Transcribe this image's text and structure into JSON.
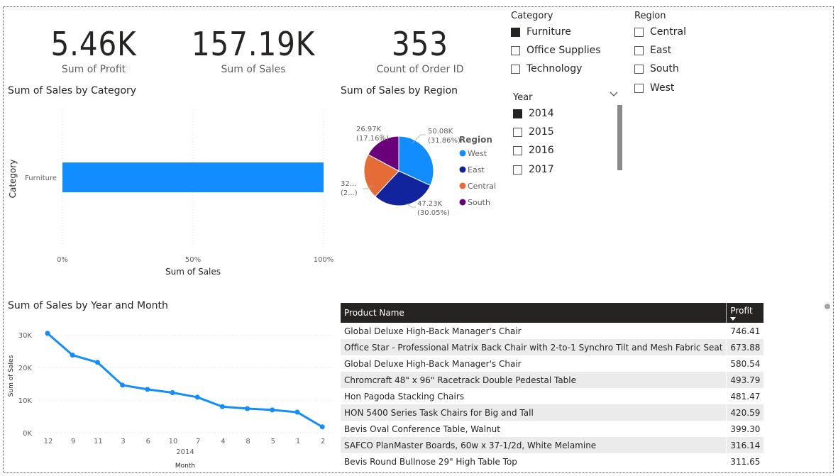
{
  "kpis": [
    {
      "value": "5.46K",
      "label": "Sum of Profit"
    },
    {
      "value": "157.19K",
      "label": "Sum of Sales"
    },
    {
      "value": "353",
      "label": "Count of Order ID"
    }
  ],
  "category_slicer": {
    "title": "Category",
    "options": [
      {
        "label": "Furniture",
        "checked": true
      },
      {
        "label": "Office Supplies",
        "checked": false
      },
      {
        "label": "Technology",
        "checked": false
      }
    ]
  },
  "region_slicer": {
    "title": "Region",
    "options": [
      {
        "label": "Central",
        "checked": false
      },
      {
        "label": "East",
        "checked": false
      },
      {
        "label": "South",
        "checked": false
      },
      {
        "label": "West",
        "checked": false
      }
    ]
  },
  "year_slicer": {
    "title": "Year",
    "chevron_icon": "chevron-down-icon",
    "options": [
      {
        "label": "2014",
        "checked": true
      },
      {
        "label": "2015",
        "checked": false
      },
      {
        "label": "2016",
        "checked": false
      },
      {
        "label": "2017",
        "checked": false
      }
    ]
  },
  "bar_visual": {
    "title": "Sum of Sales by Category"
  },
  "pie_visual": {
    "title": "Sum of Sales by Region"
  },
  "line_visual": {
    "title": "Sum of Sales by Year and Month"
  },
  "table": {
    "columns": [
      "Product Name",
      "Profit"
    ],
    "rows": [
      [
        "Global Deluxe High-Back Manager's Chair",
        "746.41"
      ],
      [
        "Office Star - Professional Matrix Back Chair with 2-to-1 Synchro Tilt and Mesh Fabric Seat",
        "673.88"
      ],
      [
        "Global Deluxe High-Back Manager's Chair",
        "580.54"
      ],
      [
        "Chromcraft 48\" x 96\" Racetrack Double Pedestal Table",
        "493.79"
      ],
      [
        "Hon Pagoda Stacking Chairs",
        "481.47"
      ],
      [
        "HON 5400 Series Task Chairs for Big and Tall",
        "420.59"
      ],
      [
        "Bevis Oval Conference Table, Walnut",
        "399.30"
      ],
      [
        "SAFCO PlanMaster Boards, 60w x 37-1/2d, White Melamine",
        "316.14"
      ],
      [
        "Bevis Round Bullnose 29\" High Table Top",
        "311.65"
      ]
    ]
  },
  "colors": {
    "west": "#118DFF",
    "east": "#12239E",
    "central": "#E66C37",
    "south": "#6B007B",
    "bar": "#118DFF",
    "line": "#118DFF"
  },
  "chart_data": [
    {
      "type": "bar",
      "orientation": "horizontal",
      "title": "Sum of Sales by Category",
      "categories": [
        "Furniture"
      ],
      "values": [
        100
      ],
      "value_unit": "%",
      "xlabel": "Sum of Sales",
      "ylabel": "Category",
      "xticks": [
        "0%",
        "50%",
        "100%"
      ],
      "xlim": [
        0,
        100
      ]
    },
    {
      "type": "pie",
      "title": "Sum of Sales by Region",
      "legend_title": "Region",
      "legend_position": "right",
      "slices": [
        {
          "name": "West",
          "value": 50.08,
          "label": "50.08K",
          "pct": "(31.86%)"
        },
        {
          "name": "East",
          "value": 47.23,
          "label": "47.23K",
          "pct": "(30.05%)"
        },
        {
          "name": "Central",
          "value": 32.91,
          "label": "32...",
          "pct": "(2...)"
        },
        {
          "name": "South",
          "value": 26.97,
          "label": "26.97K",
          "pct": "(17.16%)"
        }
      ]
    },
    {
      "type": "line",
      "title": "Sum of Sales by Year and Month",
      "xlabel": "Month",
      "x_group_label": "2014",
      "ylabel": "Sum of Sales",
      "categories": [
        "12",
        "9",
        "11",
        "3",
        "6",
        "10",
        "7",
        "4",
        "8",
        "5",
        "1",
        "2"
      ],
      "values": [
        30500,
        23800,
        21600,
        14600,
        13300,
        12300,
        10900,
        8000,
        7400,
        7000,
        6300,
        1800
      ],
      "yticks": [
        {
          "v": 0,
          "label": "0K"
        },
        {
          "v": 10000,
          "label": "10K"
        },
        {
          "v": 20000,
          "label": "20K"
        },
        {
          "v": 30000,
          "label": "30K"
        }
      ],
      "ylim": [
        0,
        32000
      ],
      "grid": true
    }
  ]
}
